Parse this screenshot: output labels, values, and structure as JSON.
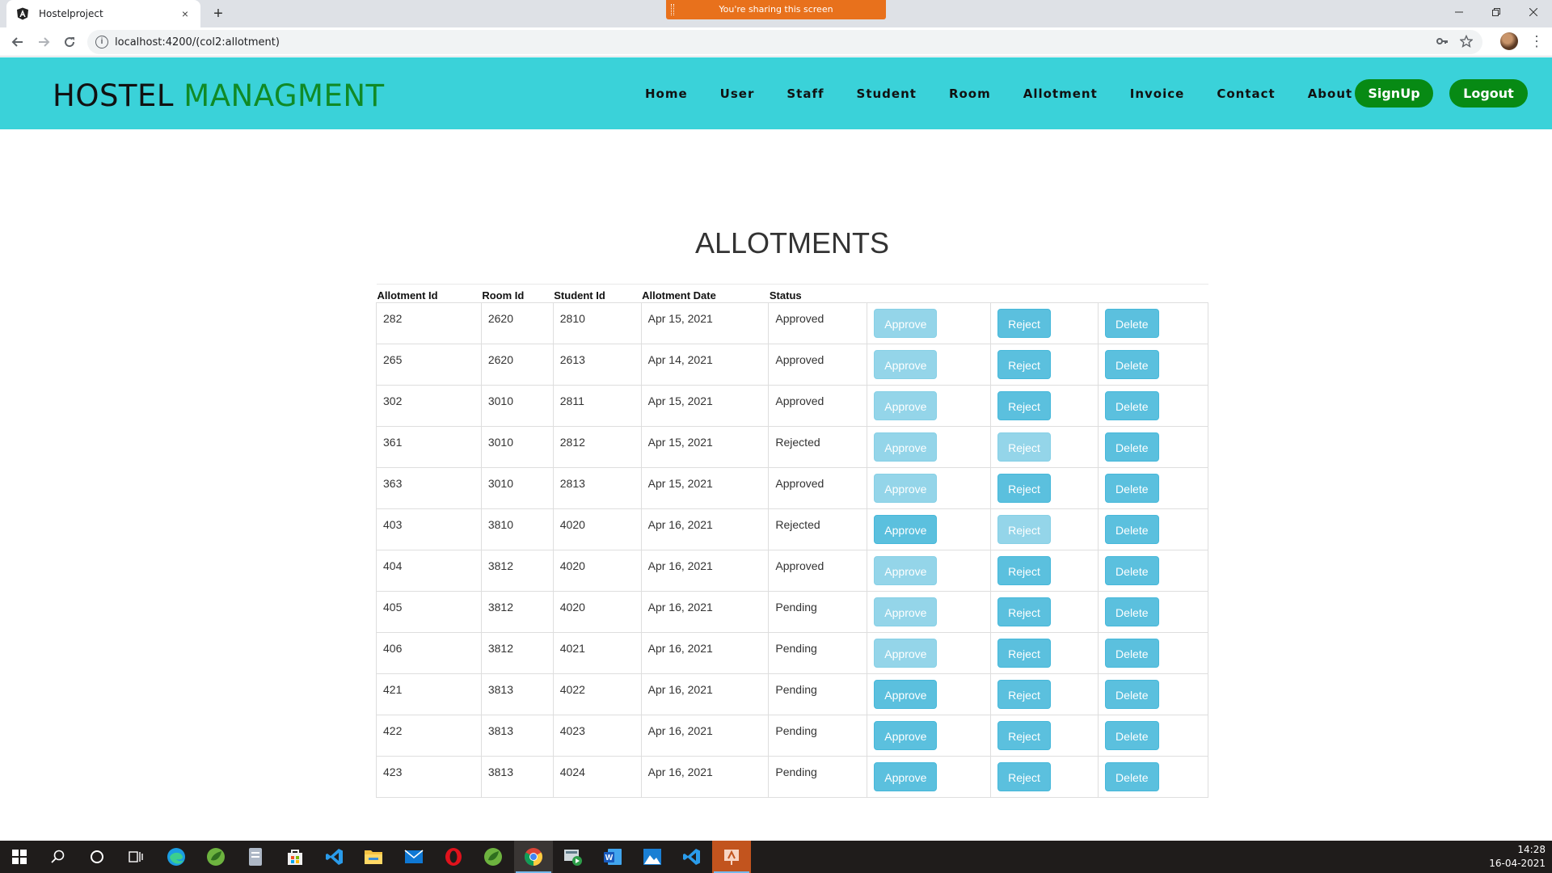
{
  "browser": {
    "tab_title": "Hostelproject",
    "new_tab_icon": "+",
    "close_icon": "×",
    "sharing_banner": "You're sharing this screen",
    "url": "localhost:4200/(col2:allotment)"
  },
  "brand": {
    "part1": "HOSTEL",
    "part2": "MANAGMENT",
    "color1": "#111111",
    "color2": "#108a26"
  },
  "nav": {
    "bg": "#3ad2d9",
    "items": [
      "Home",
      "User",
      "Staff",
      "Student",
      "Room",
      "Allotment",
      "Invoice",
      "Contact",
      "About"
    ],
    "signup": "SignUp",
    "logout": "Logout",
    "button_color": "#078a14"
  },
  "page": {
    "title": "ALLOTMENTS"
  },
  "table": {
    "headers": [
      "Allotment Id",
      "Room Id",
      "Student Id",
      "Allotment Date",
      "Status"
    ],
    "button_color": "#5bc0de",
    "rows": [
      {
        "id": "282",
        "room": "2620",
        "student": "2810",
        "date": "Apr 15, 2021",
        "status": "Approved",
        "approve": "Approve",
        "reject": "Reject",
        "delete": "Delete"
      },
      {
        "id": "265",
        "room": "2620",
        "student": "2613",
        "date": "Apr 14, 2021",
        "status": "Approved",
        "approve": "Approve",
        "reject": "Reject",
        "delete": "Delete"
      },
      {
        "id": "302",
        "room": "3010",
        "student": "2811",
        "date": "Apr 15, 2021",
        "status": "Approved",
        "approve": "Approve",
        "reject": "Reject",
        "delete": "Delete"
      },
      {
        "id": "361",
        "room": "3010",
        "student": "2812",
        "date": "Apr 15, 2021",
        "status": "Rejected",
        "approve": "Approve",
        "reject": "Reject",
        "delete": "Delete"
      },
      {
        "id": "363",
        "room": "3010",
        "student": "2813",
        "date": "Apr 15, 2021",
        "status": "Approved",
        "approve": "Approve",
        "reject": "Reject",
        "delete": "Delete"
      },
      {
        "id": "403",
        "room": "3810",
        "student": "4020",
        "date": "Apr 16, 2021",
        "status": "Rejected",
        "approve": "Approve",
        "reject": "Reject",
        "delete": "Delete"
      },
      {
        "id": "404",
        "room": "3812",
        "student": "4020",
        "date": "Apr 16, 2021",
        "status": "Approved",
        "approve": "Approve",
        "reject": "Reject",
        "delete": "Delete"
      },
      {
        "id": "405",
        "room": "3812",
        "student": "4020",
        "date": "Apr 16, 2021",
        "status": "Pending",
        "approve": "Approve",
        "reject": "Reject",
        "delete": "Delete"
      },
      {
        "id": "406",
        "room": "3812",
        "student": "4021",
        "date": "Apr 16, 2021",
        "status": "Pending",
        "approve": "Approve",
        "reject": "Reject",
        "delete": "Delete"
      },
      {
        "id": "421",
        "room": "3813",
        "student": "4022",
        "date": "Apr 16, 2021",
        "status": "Pending",
        "approve": "Approve",
        "reject": "Reject",
        "delete": "Delete"
      },
      {
        "id": "422",
        "room": "3813",
        "student": "4023",
        "date": "Apr 16, 2021",
        "status": "Pending",
        "approve": "Approve",
        "reject": "Reject",
        "delete": "Delete"
      },
      {
        "id": "423",
        "room": "3813",
        "student": "4024",
        "date": "Apr 16, 2021",
        "status": "Pending",
        "approve": "Approve",
        "reject": "Reject",
        "delete": "Delete"
      }
    ]
  },
  "taskbar": {
    "icons": [
      "windows-start-icon",
      "search-icon",
      "cortana-icon",
      "task-view-icon",
      "edge-icon",
      "spring-tool-icon",
      "file-app-icon",
      "store-icon",
      "vscode-icon",
      "file-explorer-icon",
      "mail-icon",
      "opera-icon",
      "spring-tool-icon",
      "chrome-icon",
      "media-player-icon",
      "word-icon",
      "photos-icon",
      "vscode-icon",
      "presentation-app-icon"
    ],
    "time": "14:28",
    "date": "16-04-2021"
  }
}
